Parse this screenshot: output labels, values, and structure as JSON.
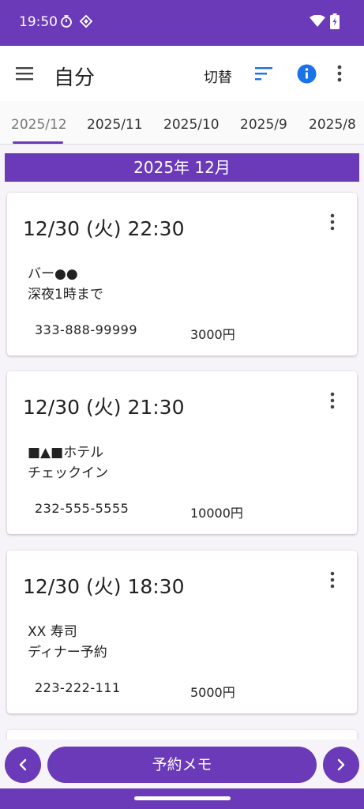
{
  "status": {
    "time": "19:50",
    "icons": [
      "timer-icon",
      "diamond-icon",
      "wifi-icon",
      "battery-icon"
    ]
  },
  "appbar": {
    "title": "自分",
    "switch_label": "切替"
  },
  "tabs": [
    "2025/12",
    "2025/11",
    "2025/10",
    "2025/9",
    "2025/8"
  ],
  "month_header": "2025年 12月",
  "entries": [
    {
      "datetime": "12/30 (火) 22:30",
      "line1": "バー●●",
      "line2": "深夜1時まで",
      "phone": "333-888-99999",
      "price": "3000円"
    },
    {
      "datetime": "12/30 (火) 21:30",
      "line1": "■▲■ホテル",
      "line2": "チェックイン",
      "phone": "232-555-5555",
      "price": "10000円"
    },
    {
      "datetime": "12/30 (火) 18:30",
      "line1": "XX 寿司",
      "line2": "ディナー予約",
      "phone": "223-222-111",
      "price": "5000円"
    }
  ],
  "bottom": {
    "main_label": "予約メモ",
    "prev_glyph": "‹",
    "next_glyph": "›"
  },
  "colors": {
    "primary": "#6a3ab8",
    "info": "#1a73e8",
    "sort": "#1a73e8"
  }
}
